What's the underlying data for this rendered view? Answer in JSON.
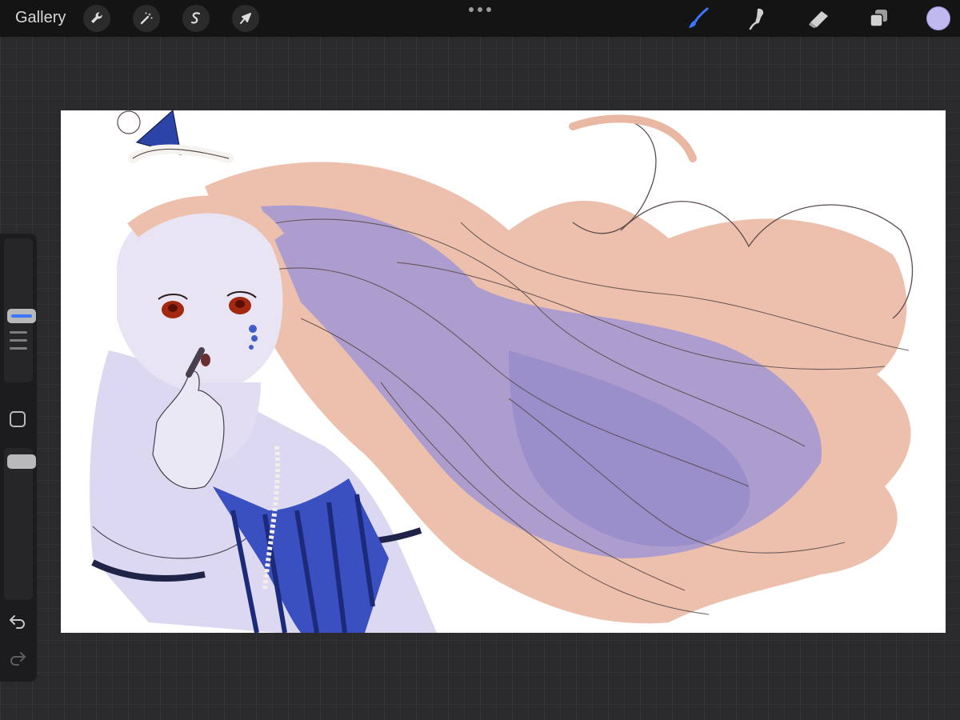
{
  "topbar": {
    "gallery_label": "Gallery",
    "left_tools": [
      {
        "icon": "wrench-icon",
        "name": "actions"
      },
      {
        "icon": "magic-wand-icon",
        "name": "adjustments"
      },
      {
        "icon": "selection-icon",
        "name": "selection"
      },
      {
        "icon": "arrow-cursor-icon",
        "name": "transform"
      }
    ],
    "menu_icon": "more-dots-icon",
    "right_tools": [
      {
        "icon": "brush-icon",
        "name": "paint",
        "active": true
      },
      {
        "icon": "smudge-icon",
        "name": "smudge",
        "active": false
      },
      {
        "icon": "eraser-icon",
        "name": "erase",
        "active": false
      },
      {
        "icon": "layers-icon",
        "name": "layers",
        "active": false
      }
    ],
    "current_color": "#c0b9ef"
  },
  "sidebar": {
    "brush_size_icon": "size-slider-icon",
    "modify_icon": "square-modify-icon",
    "opacity_icon": "opacity-slider-icon",
    "undo_icon": "undo-icon",
    "redo_icon": "redo-icon"
  },
  "canvas": {
    "background": "#ffffff",
    "accent": "#3f5cc8",
    "hair": "#e8b8a3",
    "shadow": "#8c86c9"
  }
}
